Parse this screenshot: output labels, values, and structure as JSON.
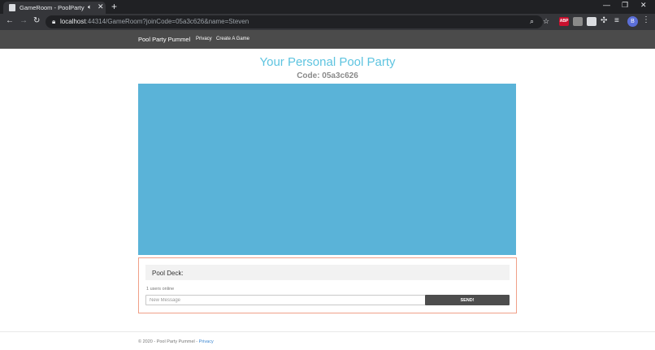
{
  "browser": {
    "tab_title": "GameRoom - PoolPartyPum",
    "new_tab_icon": "+",
    "url_host": "localhost",
    "url_path": ":44314/GameRoom?joinCode=05a3c626&name=Steven",
    "profile_initial": "B",
    "extensions": [
      {
        "name": "adblock-extension-icon",
        "label": "ABP",
        "color": "#c8102e"
      },
      {
        "name": "extension-icon-2",
        "label": "",
        "color": "#8a8a8a"
      },
      {
        "name": "extension-icon-3",
        "label": "",
        "color": "#dadce0"
      }
    ]
  },
  "nav": {
    "brand": "Pool Party Pummel",
    "links": [
      "Privacy",
      "Create A Game"
    ]
  },
  "main": {
    "title": "Your Personal Pool Party",
    "code": "Code: 05a3c626",
    "pool_color": "#5ab3d8"
  },
  "deck": {
    "title": "Pool Deck:",
    "users_online": "1 users online",
    "input_placeholder": "New Message",
    "send_label": "SEND!"
  },
  "footer": {
    "text": "© 2020 - Pool Party Pummel - ",
    "link": "Privacy"
  }
}
